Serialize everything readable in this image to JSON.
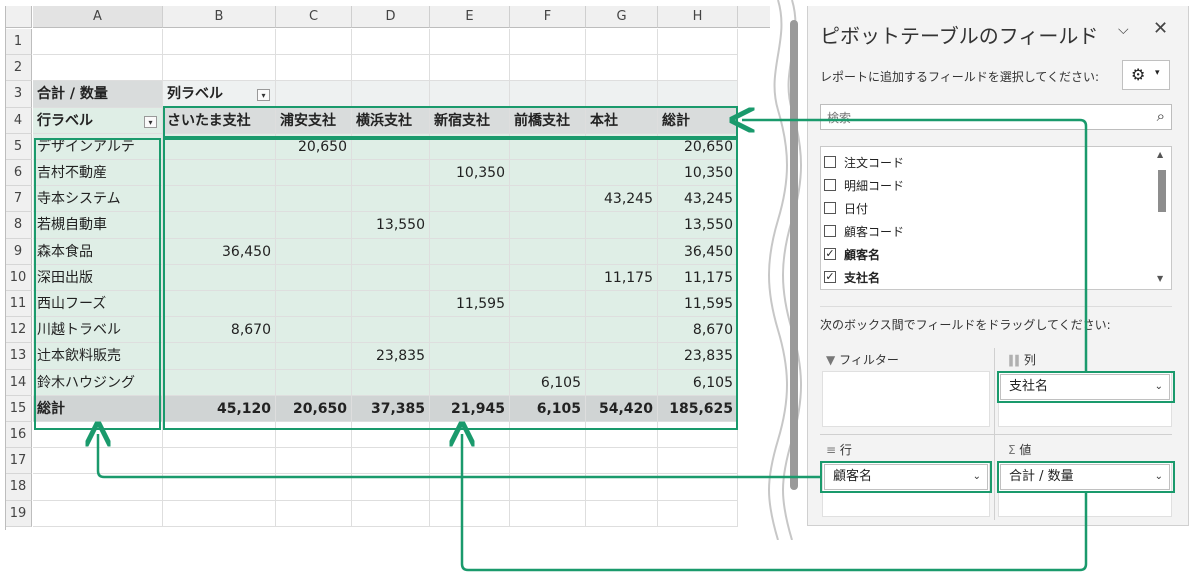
{
  "sheet": {
    "columns": [
      "A",
      "B",
      "C",
      "D",
      "E",
      "F",
      "G",
      "H"
    ],
    "row_numbers": [
      "1",
      "2",
      "3",
      "4",
      "5",
      "6",
      "7",
      "8",
      "9",
      "10",
      "11",
      "12",
      "13",
      "14",
      "15",
      "16",
      "17",
      "18",
      "19"
    ],
    "pivot": {
      "value_label": "合計 / 数量",
      "col_label": "列ラベル",
      "row_label": "行ラベル",
      "col_headers": [
        "さいたま支社",
        "浦安支社",
        "横浜支社",
        "新宿支社",
        "前橋支社",
        "本社",
        "総計"
      ],
      "rows": [
        {
          "name": "デザインアルテ",
          "values": [
            "",
            "20,650",
            "",
            "",
            "",
            "",
            "20,650"
          ]
        },
        {
          "name": "吉村不動産",
          "values": [
            "",
            "",
            "",
            "10,350",
            "",
            "",
            "10,350"
          ]
        },
        {
          "name": "寺本システム",
          "values": [
            "",
            "",
            "",
            "",
            "",
            "43,245",
            "43,245"
          ]
        },
        {
          "name": "若槻自動車",
          "values": [
            "",
            "",
            "13,550",
            "",
            "",
            "",
            "13,550"
          ]
        },
        {
          "name": "森本食品",
          "values": [
            "36,450",
            "",
            "",
            "",
            "",
            "",
            "36,450"
          ]
        },
        {
          "name": "深田出版",
          "values": [
            "",
            "",
            "",
            "",
            "",
            "11,175",
            "11,175"
          ]
        },
        {
          "name": "西山フーズ",
          "values": [
            "",
            "",
            "",
            "11,595",
            "",
            "",
            "11,595"
          ]
        },
        {
          "name": "川越トラベル",
          "values": [
            "8,670",
            "",
            "",
            "",
            "",
            "",
            "8,670"
          ]
        },
        {
          "name": "辻本飲料販売",
          "values": [
            "",
            "",
            "23,835",
            "",
            "",
            "",
            "23,835"
          ]
        },
        {
          "name": "鈴木ハウジング",
          "values": [
            "",
            "",
            "",
            "",
            "6,105",
            "",
            "6,105"
          ]
        }
      ],
      "total_label": "総計",
      "totals": [
        "45,120",
        "20,650",
        "37,385",
        "21,945",
        "6,105",
        "54,420",
        "185,625"
      ]
    }
  },
  "pane": {
    "title": "ピボットテーブルのフィールド",
    "subtitle": "レポートに追加するフィールドを選択してください:",
    "search_placeholder": "検索",
    "fields": [
      {
        "label": "注文コード",
        "checked": false
      },
      {
        "label": "明細コード",
        "checked": false
      },
      {
        "label": "日付",
        "checked": false
      },
      {
        "label": "顧客コード",
        "checked": false
      },
      {
        "label": "顧客名",
        "checked": true
      },
      {
        "label": "支社名",
        "checked": true
      }
    ],
    "drag_hint": "次のボックス間でフィールドをドラッグしてください:",
    "areas": {
      "filter": {
        "label": "フィルター",
        "items": []
      },
      "columns": {
        "label": "列",
        "items": [
          "支社名"
        ]
      },
      "rows": {
        "label": "行",
        "items": [
          "顧客名"
        ]
      },
      "values": {
        "label": "値",
        "items": [
          "合計 / 数量"
        ]
      }
    }
  },
  "colors": {
    "accent": "#1a9a6c",
    "selection": "#dfeee6",
    "header_gray": "#d9dcdc"
  }
}
